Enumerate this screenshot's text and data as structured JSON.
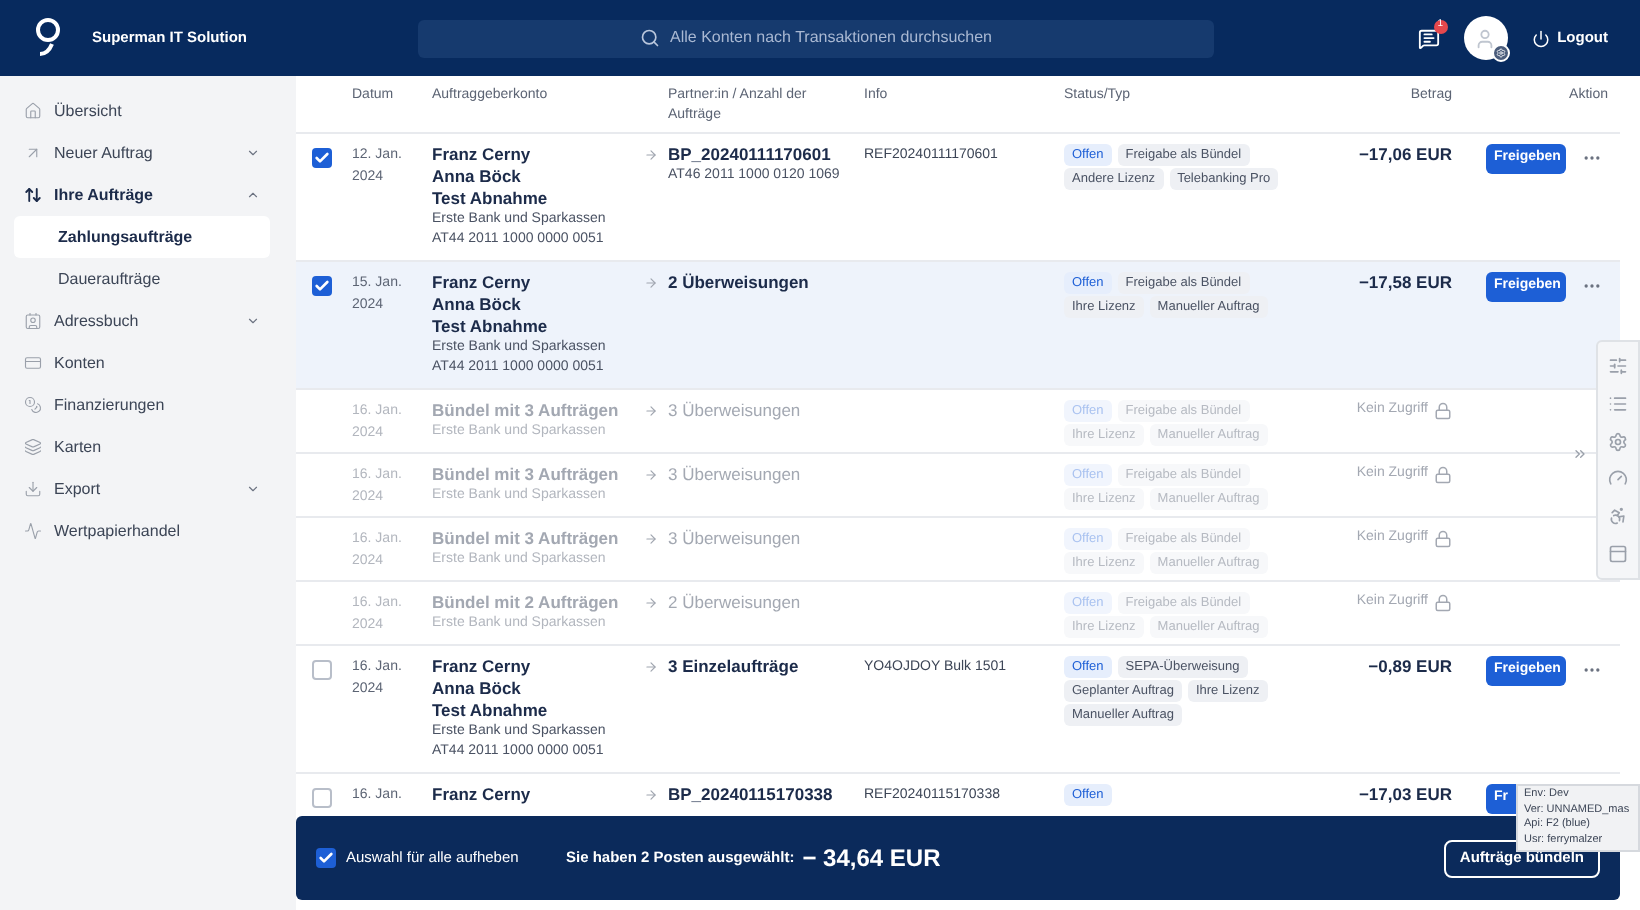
{
  "header": {
    "brand": "Superman IT Solution",
    "search": {
      "placeholder": "Alle Konten nach Transaktionen durchsuchen"
    },
    "notification_count": "1",
    "logout": "Logout"
  },
  "sidebar": {
    "items": [
      {
        "label": "Übersicht",
        "selected": false
      },
      {
        "label": "Neuer Auftrag",
        "selected": false,
        "expanded": false
      },
      {
        "label": "Ihre Aufträge",
        "selected": false,
        "expanded": true,
        "children": [
          {
            "label": "Zahlungsaufträge",
            "selected": true
          },
          {
            "label": "Daueraufträge",
            "selected": false
          }
        ]
      },
      {
        "label": "Adressbuch",
        "selected": false,
        "expanded": false
      },
      {
        "label": "Konten",
        "selected": false
      },
      {
        "label": "Finanzierungen",
        "selected": false
      },
      {
        "label": "Karten",
        "selected": false
      },
      {
        "label": "Export",
        "selected": false,
        "expanded": false
      },
      {
        "label": "Wertpapierhandel",
        "selected": false
      }
    ]
  },
  "table": {
    "columns": [
      "Datum",
      "Auftraggeberkonto",
      "Partner:in / Anzahl der Aufträge",
      "Info",
      "Status/Typ",
      "Betrag",
      "Aktion"
    ],
    "rows": [
      {
        "kind": "order",
        "checked": true,
        "highlighted": false,
        "date": "12. Jan.",
        "year": "2024",
        "names": [
          "Franz Cerny",
          "Anna Böck",
          "Test Abnahme"
        ],
        "bank": "Erste Bank und Sparkassen",
        "iban": "AT44 2011 1000 0000 0051",
        "partner": "BP_20240111170601",
        "partner_iban": "AT46 2011 1000 0120 1069",
        "info": "REF20240111170601",
        "tags": [
          {
            "label": "Offen",
            "kind": "status"
          },
          {
            "label": "Freigabe als Bündel",
            "kind": "type"
          },
          {
            "label": "Andere Lizenz",
            "kind": "type"
          },
          {
            "label": "Telebanking Pro",
            "kind": "type"
          }
        ],
        "amount": "−17,06 EUR",
        "button": "Freigeben",
        "menu": true
      },
      {
        "kind": "order",
        "checked": true,
        "highlighted": true,
        "date": "15. Jan.",
        "year": "2024",
        "names": [
          "Franz Cerny",
          "Anna Böck",
          "Test Abnahme"
        ],
        "bank": "Erste Bank und Sparkassen",
        "iban": "AT44 2011 1000 0000 0051",
        "partner": "2 Überweisungen",
        "tags": [
          {
            "label": "Offen",
            "kind": "status"
          },
          {
            "label": "Freigabe als Bündel",
            "kind": "type"
          },
          {
            "label": "Ihre Lizenz",
            "kind": "type"
          },
          {
            "label": "Manueller Auftrag",
            "kind": "type"
          }
        ],
        "amount": "−17,58 EUR",
        "button": "Freigeben",
        "menu": true
      },
      {
        "kind": "bundle",
        "date": "16. Jan.",
        "year": "2024",
        "names": [
          "Bündel mit 3 Aufträgen"
        ],
        "bank": "Erste Bank und Sparkassen",
        "partner": "3 Überweisungen",
        "tags": [
          {
            "label": "Offen",
            "kind": "status"
          },
          {
            "label": "Freigabe als Bündel",
            "kind": "type"
          },
          {
            "label": "Ihre Lizenz",
            "kind": "type"
          },
          {
            "label": "Manueller Auftrag",
            "kind": "type"
          }
        ],
        "access": "Kein Zugriff"
      },
      {
        "kind": "bundle",
        "date": "16. Jan.",
        "year": "2024",
        "names": [
          "Bündel mit 3 Aufträgen"
        ],
        "bank": "Erste Bank und Sparkassen",
        "partner": "3 Überweisungen",
        "tags": [
          {
            "label": "Offen",
            "kind": "status"
          },
          {
            "label": "Freigabe als Bündel",
            "kind": "type"
          },
          {
            "label": "Ihre Lizenz",
            "kind": "type"
          },
          {
            "label": "Manueller Auftrag",
            "kind": "type"
          }
        ],
        "access": "Kein Zugriff"
      },
      {
        "kind": "bundle",
        "date": "16. Jan.",
        "year": "2024",
        "names": [
          "Bündel mit 3 Aufträgen"
        ],
        "bank": "Erste Bank und Sparkassen",
        "partner": "3 Überweisungen",
        "tags": [
          {
            "label": "Offen",
            "kind": "status"
          },
          {
            "label": "Freigabe als Bündel",
            "kind": "type"
          },
          {
            "label": "Ihre Lizenz",
            "kind": "type"
          },
          {
            "label": "Manueller Auftrag",
            "kind": "type"
          }
        ],
        "access": "Kein Zugriff"
      },
      {
        "kind": "bundle",
        "date": "16. Jan.",
        "year": "2024",
        "names": [
          "Bündel mit 2 Aufträgen"
        ],
        "bank": "Erste Bank und Sparkassen",
        "partner": "2 Überweisungen",
        "tags": [
          {
            "label": "Offen",
            "kind": "status"
          },
          {
            "label": "Freigabe als Bündel",
            "kind": "type"
          },
          {
            "label": "Ihre Lizenz",
            "kind": "type"
          },
          {
            "label": "Manueller Auftrag",
            "kind": "type"
          }
        ],
        "access": "Kein Zugriff"
      },
      {
        "kind": "order",
        "checked": false,
        "highlighted": false,
        "date": "16. Jan.",
        "year": "2024",
        "names": [
          "Franz Cerny",
          "Anna Böck",
          "Test Abnahme"
        ],
        "bank": "Erste Bank und Sparkassen",
        "iban": "AT44 2011 1000 0000 0051",
        "partner": "3 Einzelaufträge",
        "info": "YO4OJDOY Bulk 1501",
        "tags": [
          {
            "label": "Offen",
            "kind": "status"
          },
          {
            "label": "SEPA-Überweisung",
            "kind": "type"
          },
          {
            "label": "Geplanter Auftrag",
            "kind": "type"
          },
          {
            "label": "Ihre Lizenz",
            "kind": "type"
          },
          {
            "label": "Manueller Auftrag",
            "kind": "type"
          }
        ],
        "amount": "−0,89 EUR",
        "button": "Freigeben",
        "menu": true
      },
      {
        "kind": "order",
        "checked": false,
        "highlighted": false,
        "date": "16. Jan.",
        "names": [
          "Franz Cerny"
        ],
        "partner": "BP_20240115170338",
        "info": "REF20240115170338",
        "tags": [
          {
            "label": "Offen",
            "kind": "status"
          }
        ],
        "amount": "−17,03 EUR",
        "button": "Fr"
      }
    ]
  },
  "selection_bar": {
    "checked": true,
    "toggle_label": "Auswahl für alle aufheben",
    "summary": "Sie haben 2 Posten ausgewählt:",
    "total": "− 34,64 EUR",
    "button": "Aufträge bündeln"
  },
  "debug_info": [
    "Env: Dev",
    "Ver: UNNAMED_mas",
    "Api: F2 (blue)",
    "Usr: ferrymalzer"
  ]
}
